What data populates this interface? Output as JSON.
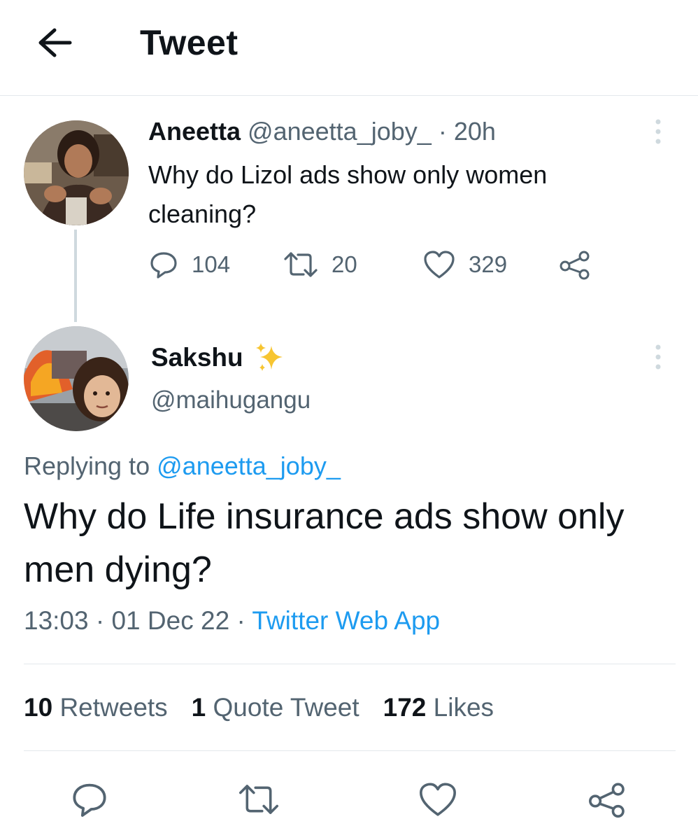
{
  "header": {
    "title": "Tweet",
    "back_icon": "arrow-left-icon"
  },
  "parent_tweet": {
    "name": "Aneetta",
    "handle": "@aneetta_joby_",
    "separator": "·",
    "time": "20h",
    "text": "Why do Lizol ads show only women cleaning?",
    "replies": "104",
    "retweets": "20",
    "likes": "329"
  },
  "main_tweet": {
    "name": "Sakshu",
    "name_emoji": "sparkles-icon",
    "handle": "@maihugangu",
    "replying_label": "Replying to",
    "replying_handle": "@aneetta_joby_",
    "text": "Why do Life insurance ads show only men dying?",
    "time": "13:03",
    "date": "01 Dec 22",
    "sep": "·",
    "source": "Twitter Web App"
  },
  "stats": {
    "retweets_count": "10",
    "retweets_label": "Retweets",
    "quotes_count": "1",
    "quotes_label": "Quote Tweet",
    "likes_count": "172",
    "likes_label": "Likes"
  },
  "colors": {
    "accent": "#1d9bf0",
    "secondary_text": "#536471",
    "primary_text": "#0f1419",
    "divider": "#e3e8ec"
  }
}
